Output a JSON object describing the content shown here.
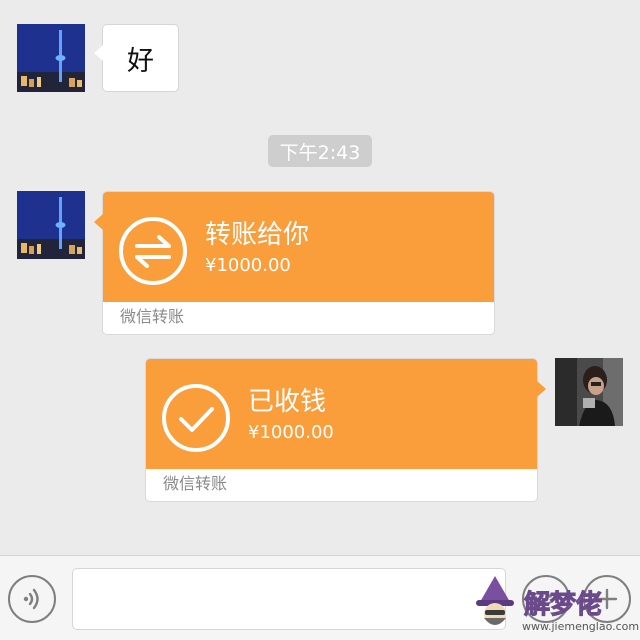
{
  "messages": {
    "reply_text": "好",
    "timestamp": "下午2:43",
    "incoming_transfer": {
      "title": "转账给你",
      "amount": "¥1000.00",
      "footer": "微信转账"
    },
    "outgoing_transfer": {
      "title": "已收钱",
      "amount": "¥1000.00",
      "footer": "微信转账"
    }
  },
  "icons": {
    "transfer": "transfer-arrows-icon",
    "received": "checkmark-icon",
    "voice": "voice-icon",
    "emoji": "emoji-icon",
    "add": "plus-icon"
  },
  "colors": {
    "transfer_orange": "#fa9d3b",
    "chat_background": "#ebebeb",
    "timestamp_pill": "#cecece"
  },
  "watermark": {
    "logo_text": "解梦佬",
    "url": "www.jiemenglao.com"
  }
}
